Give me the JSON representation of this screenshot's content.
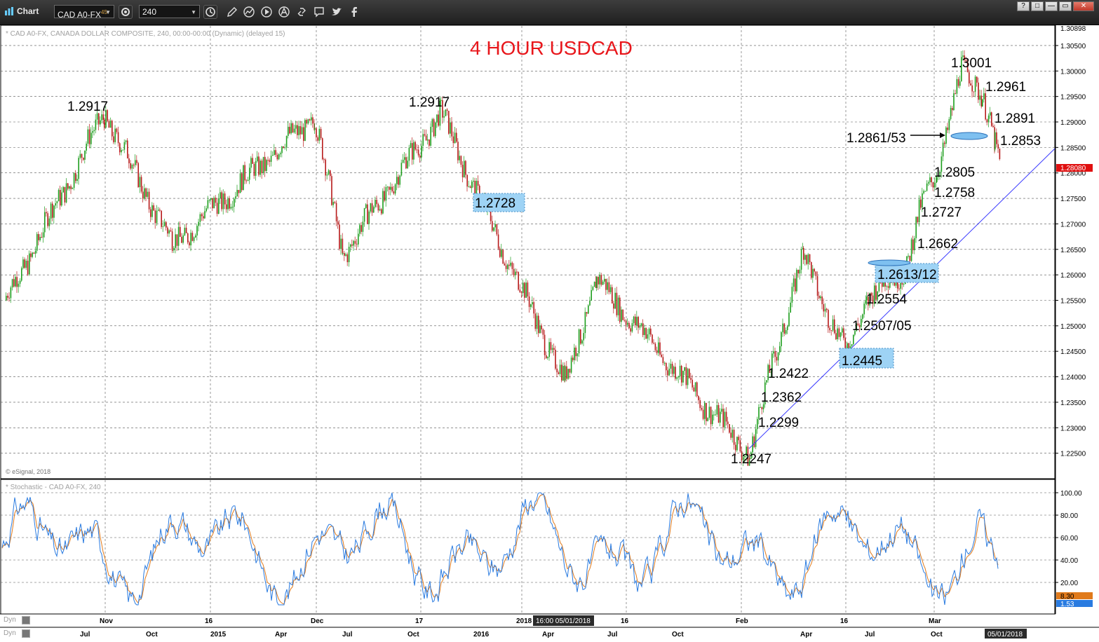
{
  "window": {
    "title": "Chart",
    "symbol_field": "CAD A0-FX",
    "symbol_superscript": "45",
    "interval_field": "240",
    "win_buttons": [
      "?",
      "□",
      "—",
      "▭",
      "✕"
    ]
  },
  "toolbar_icons": [
    "settings-icon",
    "clock-icon",
    "pencil-icon",
    "trend-icon",
    "play-icon",
    "alert-icon",
    "link-icon",
    "comment-icon",
    "twitter-icon",
    "facebook-icon"
  ],
  "chart_header": "* CAD A0-FX, CANADA DOLLAR COMPOSITE, 240, 00:00-00:00 (Dynamic) (delayed 15)",
  "chart_title": "4 HOUR USDCAD",
  "copyright": "© eSignal, 2018",
  "stoch_header": "* Stochastic - CAD A0-FX, 240",
  "price_axis_top": "1.30898",
  "price_ticks": [
    "1.30500",
    "1.30000",
    "1.29500",
    "1.29000",
    "1.28500",
    "1.28000",
    "1.27500",
    "1.27000",
    "1.26500",
    "1.26000",
    "1.25500",
    "1.25000",
    "1.24500",
    "1.24000",
    "1.23500",
    "1.23000",
    "1.22500"
  ],
  "last_price": "1.28080",
  "stoch_ticks": [
    "100.00",
    "80.00",
    "60.00",
    "40.00",
    "20.00"
  ],
  "stoch_values": [
    "8.30",
    "1.53"
  ],
  "time_labels_top": [
    "Nov",
    "16",
    "Dec",
    "17",
    "2018",
    "16",
    "Feb",
    "16",
    "Mar"
  ],
  "time_labels_bottom": [
    "Jul",
    "Oct",
    "2015",
    "Apr",
    "Jul",
    "Oct",
    "2016",
    "Apr",
    "Jul",
    "Oct",
    "Apr",
    "Jul",
    "Oct"
  ],
  "crosshair_time": "16:00 05/01/2018",
  "cursor_date": "05/01/2018",
  "dyn_label": "Dyn",
  "annotations": [
    "1.2917",
    "1.2917",
    "1.2728",
    "1.3001",
    "1.2961",
    "1.2891",
    "1.2861/53",
    "1.2853",
    "1.2805",
    "1.2758",
    "1.2727",
    "1.2662",
    "1.2613/12",
    "1.2554",
    "1.2507/05",
    "1.2445",
    "1.2422",
    "1.2362",
    "1.2299",
    "1.2247"
  ],
  "colors": {
    "title_red": "#e8161b",
    "up_candle": "#1f9e1f",
    "down_candle": "#b71b1b",
    "trendline": "#3a3aff",
    "box_fill": "#9ed3f5",
    "stoch_k": "#2a7be0",
    "stoch_d": "#e07a1b",
    "last_price_bg": "#e01010"
  },
  "chart_data": {
    "type": "candlestick",
    "title": "4 HOUR USDCAD",
    "y_axis": "price",
    "ylim": [
      1.22,
      1.30898
    ],
    "swing_points": [
      {
        "label": "start",
        "value": 1.255
      },
      {
        "label": "1.2917",
        "value": 1.2917
      },
      {
        "label": "low",
        "value": 1.266
      },
      {
        "label": "high",
        "value": 1.291
      },
      {
        "label": "low",
        "value": 1.264
      },
      {
        "label": "1.2917",
        "value": 1.2917
      },
      {
        "label": "1.2728",
        "value": 1.2728
      },
      {
        "label": "low",
        "value": 1.239
      },
      {
        "label": "high",
        "value": 1.259
      },
      {
        "label": "1.2247",
        "value": 1.2247
      },
      {
        "label": "1.2422",
        "value": 1.2422
      },
      {
        "label": "high",
        "value": 1.264
      },
      {
        "label": "1.2445",
        "value": 1.2445
      },
      {
        "label": "1.2554",
        "value": 1.2554
      },
      {
        "label": "1.2613/12",
        "value": 1.2613
      },
      {
        "label": "1.2727",
        "value": 1.2727
      },
      {
        "label": "1.2805",
        "value": 1.2805
      },
      {
        "label": "1.3001",
        "value": 1.3001
      },
      {
        "label": "1.2961",
        "value": 1.2961
      },
      {
        "label": "1.2891",
        "value": 1.2891
      },
      {
        "label": "1.2853",
        "value": 1.2853
      },
      {
        "label": "last",
        "value": 1.2808
      }
    ],
    "stochastic": {
      "k_last": 1.53,
      "d_last": 8.3,
      "range": [
        0,
        100
      ]
    }
  }
}
